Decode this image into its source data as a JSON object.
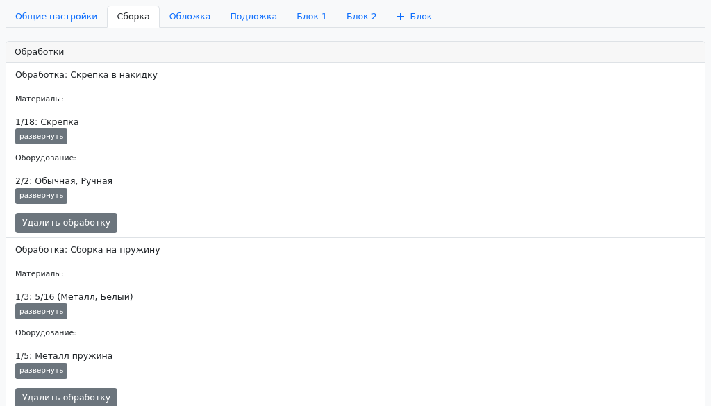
{
  "tabs": [
    {
      "label": "Общие настройки",
      "selected": false,
      "kind": "tab"
    },
    {
      "label": "Сборка",
      "selected": true,
      "kind": "tab"
    },
    {
      "label": "Обложка",
      "selected": false,
      "kind": "tab"
    },
    {
      "label": "Подложка",
      "selected": false,
      "kind": "tab"
    },
    {
      "label": "Блок 1",
      "selected": false,
      "kind": "tab"
    },
    {
      "label": "Блок 2",
      "selected": false,
      "kind": "tab"
    },
    {
      "label": "Блок",
      "selected": false,
      "kind": "add"
    }
  ],
  "card": {
    "header": "Обработки",
    "operations": [
      {
        "title": "Обработка: Скрепка в накидку",
        "sections": [
          {
            "label": "Материалы:",
            "value": "1/18: Скрепка",
            "button": "развернуть"
          },
          {
            "label": "Оборудование:",
            "value": "2/2: Обычная, Ручная",
            "button": "развернуть"
          }
        ],
        "delete_button": "Удалить обработку"
      },
      {
        "title": "Обработка: Сборка на пружину",
        "sections": [
          {
            "label": "Материалы:",
            "value": "1/3: 5/16 (Металл, Белый)",
            "button": "развернуть"
          },
          {
            "label": "Оборудование:",
            "value": "1/5: Металл пружина",
            "button": "развернуть"
          }
        ],
        "delete_button": "Удалить обработку"
      }
    ]
  }
}
